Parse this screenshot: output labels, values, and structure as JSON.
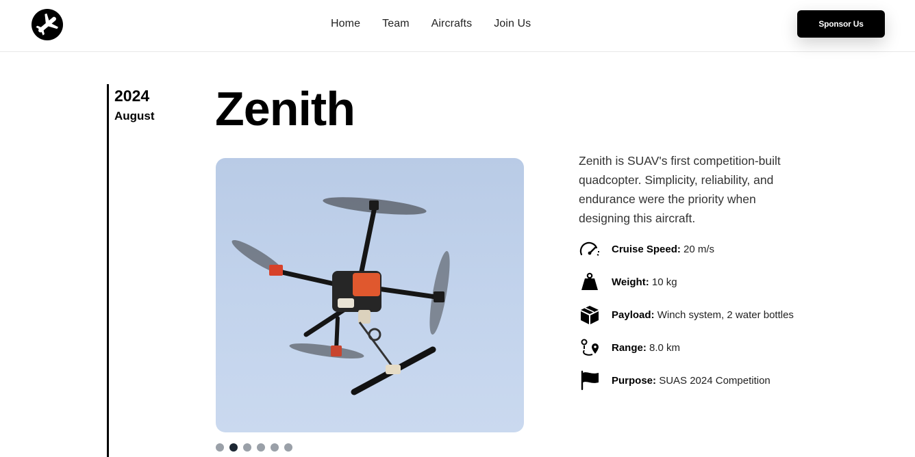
{
  "header": {
    "nav": [
      "Home",
      "Team",
      "Aircrafts",
      "Join Us"
    ],
    "sponsor_label": "Sponsor Us"
  },
  "timeline": {
    "year": "2024",
    "month": "August"
  },
  "aircraft": {
    "name": "Zenith",
    "description": "Zenith is SUAV's first competition-built quadcopter. Simplicity, reliability, and endurance were the priority when designing this aircraft.",
    "specs": [
      {
        "icon": "speedometer-icon",
        "label": "Cruise Speed:",
        "value": "20 m/s"
      },
      {
        "icon": "weight-icon",
        "label": "Weight:",
        "value": "10 kg"
      },
      {
        "icon": "package-icon",
        "label": "Payload:",
        "value": "Winch system, 2 water bottles"
      },
      {
        "icon": "route-icon",
        "label": "Range:",
        "value": "8.0 km"
      },
      {
        "icon": "flag-icon",
        "label": "Purpose:",
        "value": "SUAS 2024 Competition"
      }
    ]
  },
  "carousel": {
    "count": 6,
    "active": 2
  },
  "colors": {
    "accent": "#000000",
    "dot_inactive": "#9aa0a8",
    "dot_active": "#1d2733",
    "sky": "#c2d3ec"
  }
}
